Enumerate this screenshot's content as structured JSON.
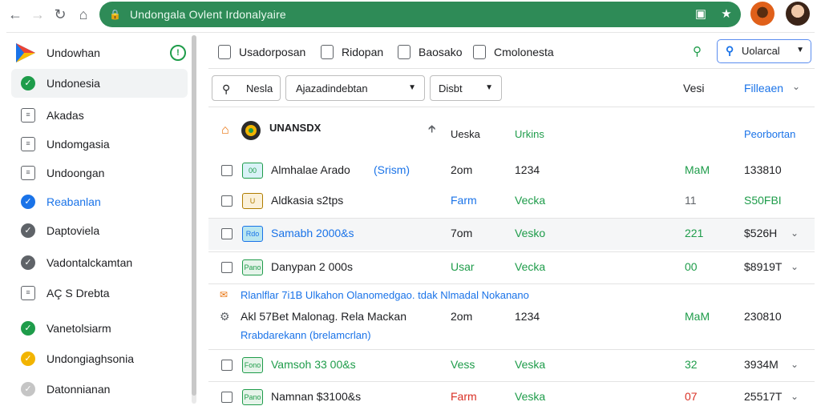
{
  "browser": {
    "url": "Undongala Ovlent Irdonalyaire",
    "back_icon": "arrow-left-icon",
    "forward_icon": "arrow-right-icon",
    "reload_icon": "reload-icon",
    "home_icon": "home-icon"
  },
  "sidebar": {
    "brand": "Undowhan",
    "items": [
      {
        "label": "Undonesia",
        "icon": "check-circle-icon",
        "color": "#1e9c4a",
        "active": true
      },
      {
        "label": "Akadas",
        "icon": "chart-icon"
      },
      {
        "label": "Undomgasia",
        "icon": "document-icon"
      },
      {
        "label": "Undoongan",
        "icon": "calendar-icon"
      },
      {
        "label": "Reabanlan",
        "icon": "lock-icon",
        "color": "#1a73e8"
      },
      {
        "label": "Daptoviela",
        "icon": "location-icon",
        "color": "#5f6368"
      },
      {
        "label": "Vadontalckamtan",
        "icon": "gear-icon",
        "color": "#5f6368"
      },
      {
        "label": "AÇ S Drebta",
        "icon": "list-icon"
      },
      {
        "label": "Vanetolsiarm",
        "icon": "arrow-up-circle-icon",
        "color": "#1e9c4a"
      },
      {
        "label": "Undongiaghsonia",
        "icon": "pencil-circle-icon",
        "color": "#f2b400"
      },
      {
        "label": "Datonnianan",
        "icon": "check-grey-icon",
        "color": "#c5c5c5"
      }
    ]
  },
  "toolbar": {
    "items": [
      "Usadorposan",
      "Ridopan",
      "Baosako",
      "Cmolonesta"
    ],
    "select": "Uolarcal"
  },
  "filters": {
    "search": "Nesla",
    "dropdown1": "Ajazadindebtan",
    "dropdown2": "Disbt",
    "right1": "Vesi",
    "right2": "Filleaen"
  },
  "table": {
    "header": {
      "name": "UNANSDX",
      "col2": "Ueska",
      "col3": "Urkins",
      "col5": "Peorbortan"
    },
    "rows": [
      {
        "tag": "00",
        "name": "Almhalae Arado",
        "sub": "(Srism)",
        "c2": "2om",
        "c3": "1234",
        "c4": "MaM",
        "c5": "133810",
        "tagc": "#d9f2f7",
        "tagt": "#1e9c4a",
        "namecls": "",
        "c2cls": "",
        "c3cls": "",
        "c4cls": "green",
        "chev": false
      },
      {
        "tag": "U",
        "name": "Aldkasia s2tps",
        "sub": "",
        "c2": "Farm",
        "c3": "Vecka",
        "c4": "11",
        "c5": "S50FBI",
        "tagc": "#fbf1d9",
        "tagt": "#b07d00",
        "namecls": "",
        "c2cls": "blue",
        "c3cls": "green",
        "c4cls": "grey",
        "c5cls": "green",
        "chev": false
      },
      {
        "tag": "Rdo",
        "name": "Samabh 2000&s",
        "sub": "",
        "c2": "7om",
        "c3": "Vesko",
        "c4": "221",
        "c5": "$526H",
        "tagc": "#b9e6f0",
        "tagt": "#1a73e8",
        "namecls": "blue",
        "c2cls": "",
        "c3cls": "green",
        "c4cls": "green",
        "chev": true
      },
      {
        "tag": "Pano",
        "name": "Danypan 2 000s",
        "sub": "",
        "c2": "Usar",
        "c3": "Vecka",
        "c4": "00",
        "c5": "$8919T",
        "tagc": "#e6f4ea",
        "tagt": "#1e9c4a",
        "namecls": "",
        "c2cls": "green",
        "c3cls": "green",
        "c4cls": "green",
        "chev": true
      },
      {
        "tag": "Fono",
        "name": "Vamsoh 33 00&s",
        "sub": "",
        "c2": "Vess",
        "c3": "Veska",
        "c4": "32",
        "c5": "3934M",
        "tagc": "#e6f4ea",
        "tagt": "#1e9c4a",
        "namecls": "green",
        "c2cls": "green",
        "c3cls": "green",
        "c4cls": "green",
        "chev": true
      },
      {
        "tag": "Pano",
        "name": "Namnan $3100&s",
        "sub": "",
        "c2": "Farm",
        "c3": "Veska",
        "c4": "07",
        "c5": "25517T",
        "tagc": "#e6f4ea",
        "tagt": "#1e9c4a",
        "namecls": "",
        "c2cls": "red",
        "c3cls": "green",
        "c4cls": "red",
        "chev": true
      }
    ],
    "expanded": {
      "line1": "Rlanlflar 7i1B Ulkahon Olanomedgao. tdak Nlmadal Nokanano",
      "line2_name": "Akl 57Bet Malonag. Rela Mackan",
      "line2_c2": "2om",
      "line2_c3": "1234",
      "line2_c4": "MaM",
      "line2_c5": "230810",
      "line3": "Rrabdarekann (brelamcrlan)"
    }
  }
}
